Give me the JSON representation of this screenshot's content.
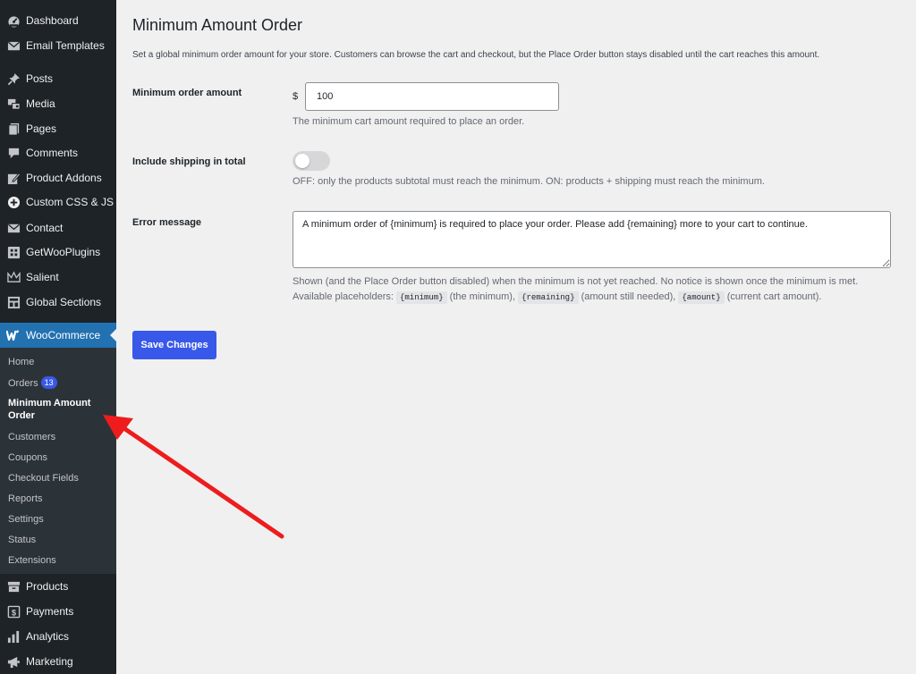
{
  "sidebar": {
    "items": [
      {
        "label": "Dashboard",
        "icon": "dashboard-icon"
      },
      {
        "label": "Email Templates",
        "icon": "email-icon"
      },
      {
        "label": "Posts",
        "icon": "pin-icon"
      },
      {
        "label": "Media",
        "icon": "media-icon"
      },
      {
        "label": "Pages",
        "icon": "pages-icon"
      },
      {
        "label": "Comments",
        "icon": "comment-icon"
      },
      {
        "label": "Product Addons",
        "icon": "edit-icon"
      },
      {
        "label": "Custom CSS & JS",
        "icon": "plus-circle-icon"
      },
      {
        "label": "Contact",
        "icon": "envelope-icon"
      },
      {
        "label": "GetWooPlugins",
        "icon": "grid-icon"
      },
      {
        "label": "Salient",
        "icon": "crown-icon"
      },
      {
        "label": "Global Sections",
        "icon": "layout-icon"
      }
    ],
    "woocommerce": {
      "label": "WooCommerce",
      "icon": "woocommerce-icon"
    },
    "submenu": {
      "home": "Home",
      "orders": "Orders",
      "orders_count": "13",
      "minimum_amount_order": "Minimum Amount Order",
      "customers": "Customers",
      "coupons": "Coupons",
      "checkout_fields": "Checkout Fields",
      "reports": "Reports",
      "settings": "Settings",
      "status": "Status",
      "extensions": "Extensions"
    },
    "bottom_items": [
      {
        "label": "Products",
        "icon": "archive-icon"
      },
      {
        "label": "Payments",
        "icon": "dollar-icon"
      },
      {
        "label": "Analytics",
        "icon": "bar-chart-icon"
      },
      {
        "label": "Marketing",
        "icon": "megaphone-icon"
      }
    ]
  },
  "main": {
    "title": "Minimum Amount Order",
    "description": "Set a global minimum order amount for your store. Customers can browse the cart and checkout, but the Place Order button stays disabled until the cart reaches this amount.",
    "min_amount": {
      "label": "Minimum order amount",
      "currency": "$",
      "value": "100",
      "help": "The minimum cart amount required to place an order."
    },
    "shipping": {
      "label": "Include shipping in total",
      "enabled": false,
      "help": "OFF: only the products subtotal must reach the minimum. ON: products + shipping must reach the minimum."
    },
    "error_message": {
      "label": "Error message",
      "value": "A minimum order of {minimum} is required to place your order. Please add {remaining} more to your cart to continue.",
      "help_line1": "Shown (and the Place Order button disabled) when the minimum is not yet reached. No notice is shown once the minimum is met.",
      "help_prefix": "Available placeholders:",
      "ph_minimum": "{minimum}",
      "ph_minimum_desc": "(the minimum),",
      "ph_remaining": "{remaining}",
      "ph_remaining_desc": "(amount still needed),",
      "ph_amount": "{amount}",
      "ph_amount_desc": "(current cart amount)."
    },
    "save_label": "Save Changes"
  },
  "colors": {
    "sidebar_bg": "#1d2327",
    "submenu_bg": "#2c3338",
    "woo_active": "#2271b1",
    "primary_button": "#3858e9",
    "annotation_arrow": "#ee1c1c"
  }
}
